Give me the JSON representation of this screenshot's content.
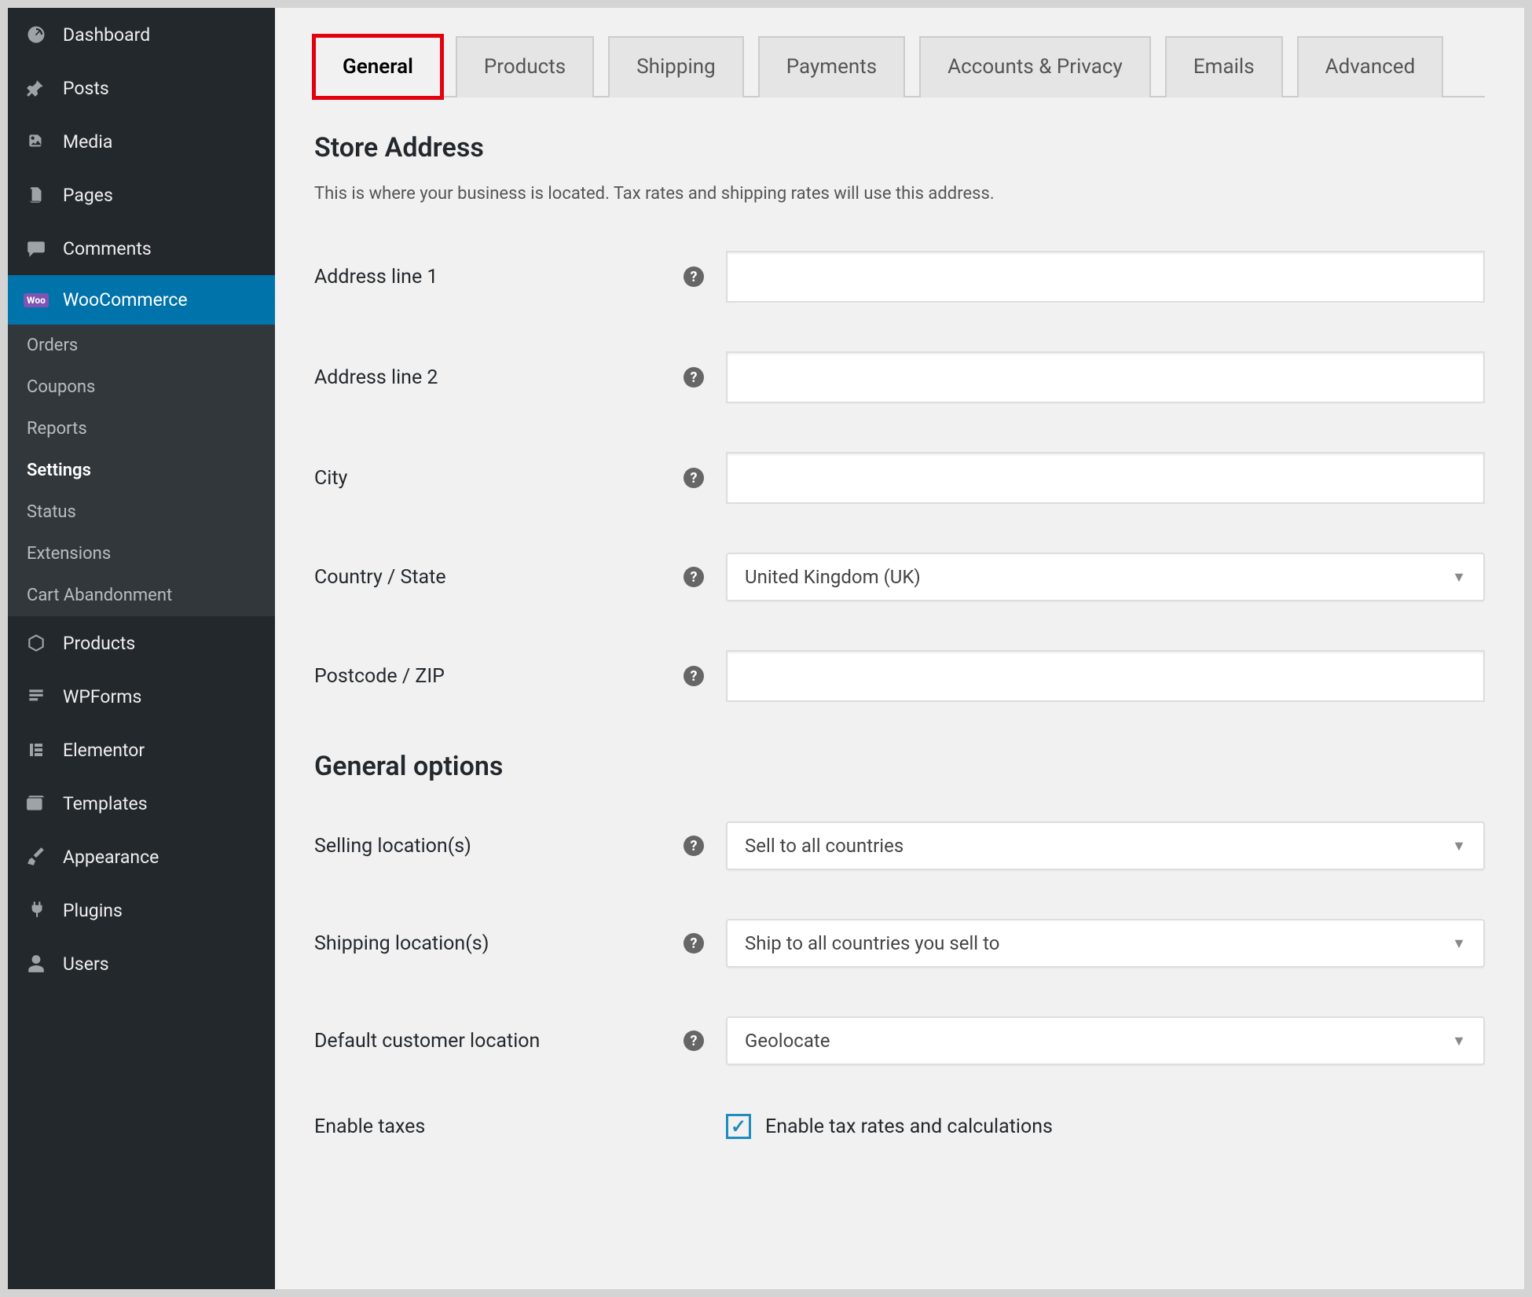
{
  "sidebar": {
    "items": [
      {
        "label": "Dashboard",
        "icon": "gauge-icon"
      },
      {
        "label": "Posts",
        "icon": "pin-icon"
      },
      {
        "label": "Media",
        "icon": "media-icon"
      },
      {
        "label": "Pages",
        "icon": "pages-icon"
      },
      {
        "label": "Comments",
        "icon": "comment-icon"
      },
      {
        "label": "WooCommerce",
        "icon": "woo-icon",
        "active": true
      },
      {
        "label": "Products",
        "icon": "box-icon"
      },
      {
        "label": "WPForms",
        "icon": "form-icon"
      },
      {
        "label": "Elementor",
        "icon": "elementor-icon"
      },
      {
        "label": "Templates",
        "icon": "templates-icon"
      },
      {
        "label": "Appearance",
        "icon": "brush-icon"
      },
      {
        "label": "Plugins",
        "icon": "plug-icon"
      },
      {
        "label": "Users",
        "icon": "user-icon"
      }
    ],
    "sub": [
      {
        "label": "Orders"
      },
      {
        "label": "Coupons"
      },
      {
        "label": "Reports"
      },
      {
        "label": "Settings",
        "active": true
      },
      {
        "label": "Status"
      },
      {
        "label": "Extensions"
      },
      {
        "label": "Cart Abandonment"
      }
    ]
  },
  "tabs": [
    {
      "label": "General",
      "active": true
    },
    {
      "label": "Products"
    },
    {
      "label": "Shipping"
    },
    {
      "label": "Payments"
    },
    {
      "label": "Accounts & Privacy"
    },
    {
      "label": "Emails"
    },
    {
      "label": "Advanced"
    }
  ],
  "section1": {
    "title": "Store Address",
    "desc": "This is where your business is located. Tax rates and shipping rates will use this address.",
    "fields": [
      {
        "label": "Address line 1",
        "type": "text",
        "value": ""
      },
      {
        "label": "Address line 2",
        "type": "text",
        "value": ""
      },
      {
        "label": "City",
        "type": "text",
        "value": ""
      },
      {
        "label": "Country / State",
        "type": "select",
        "value": "United Kingdom (UK)"
      },
      {
        "label": "Postcode / ZIP",
        "type": "text",
        "value": ""
      }
    ]
  },
  "section2": {
    "title": "General options",
    "fields": [
      {
        "label": "Selling location(s)",
        "type": "select",
        "value": "Sell to all countries"
      },
      {
        "label": "Shipping location(s)",
        "type": "select",
        "value": "Ship to all countries you sell to"
      },
      {
        "label": "Default customer location",
        "type": "select",
        "value": "Geolocate"
      },
      {
        "label": "Enable taxes",
        "type": "checkbox",
        "checked": true,
        "text": "Enable tax rates and calculations"
      }
    ]
  }
}
